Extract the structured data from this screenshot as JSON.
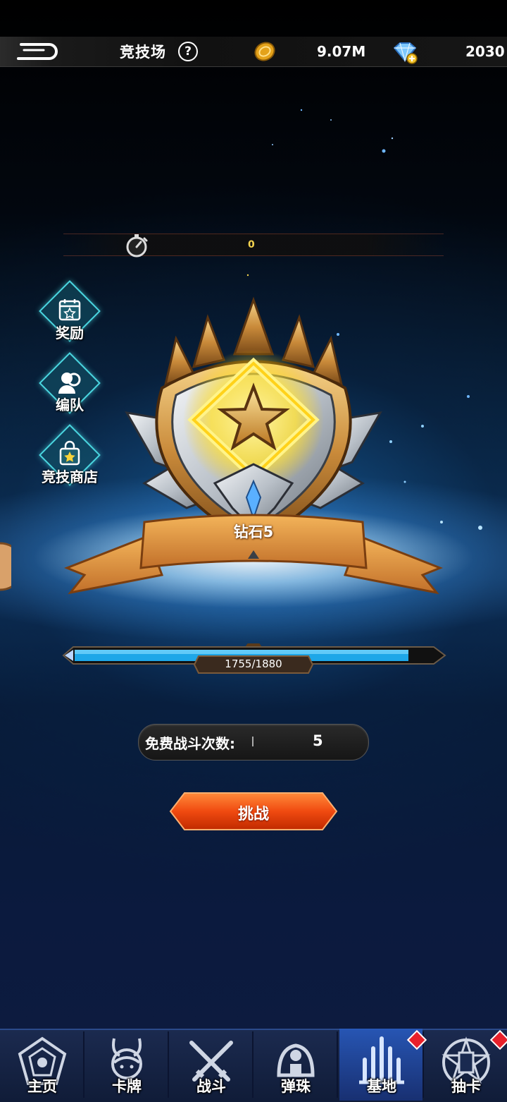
{
  "header": {
    "title": "竞技场",
    "help_icon": "?",
    "gold": "9.07M",
    "gems": "2030"
  },
  "timer": {
    "value": "0"
  },
  "side_menu": [
    {
      "label": "奖励",
      "icon": "calendar-star-icon"
    },
    {
      "label": "编队",
      "icon": "team-icon"
    },
    {
      "label": "竞技商店",
      "icon": "shop-bag-icon"
    }
  ],
  "rank": {
    "label": "钻石5"
  },
  "progress": {
    "text": "1755/1880",
    "current": 1755,
    "max": 1880
  },
  "free_battles": {
    "label": "免费战斗次数:",
    "value": "5"
  },
  "challenge_button": {
    "label": "挑战"
  },
  "nav": [
    {
      "label": "主页",
      "icon": "home-icon",
      "active": false,
      "badge": false
    },
    {
      "label": "卡牌",
      "icon": "card-character-icon",
      "active": false,
      "badge": false
    },
    {
      "label": "战斗",
      "icon": "crossed-swords-icon",
      "active": false,
      "badge": false
    },
    {
      "label": "弹珠",
      "icon": "marble-icon",
      "active": false,
      "badge": false
    },
    {
      "label": "基地",
      "icon": "base-tower-icon",
      "active": true,
      "badge": true
    },
    {
      "label": "抽卡",
      "icon": "summon-icon",
      "active": false,
      "badge": true
    }
  ],
  "colors": {
    "accent_cyan": "#4ad6e0",
    "button_orange": "#f04a10",
    "badge_red": "#e8202a",
    "rank_gold": "#e0a040"
  }
}
